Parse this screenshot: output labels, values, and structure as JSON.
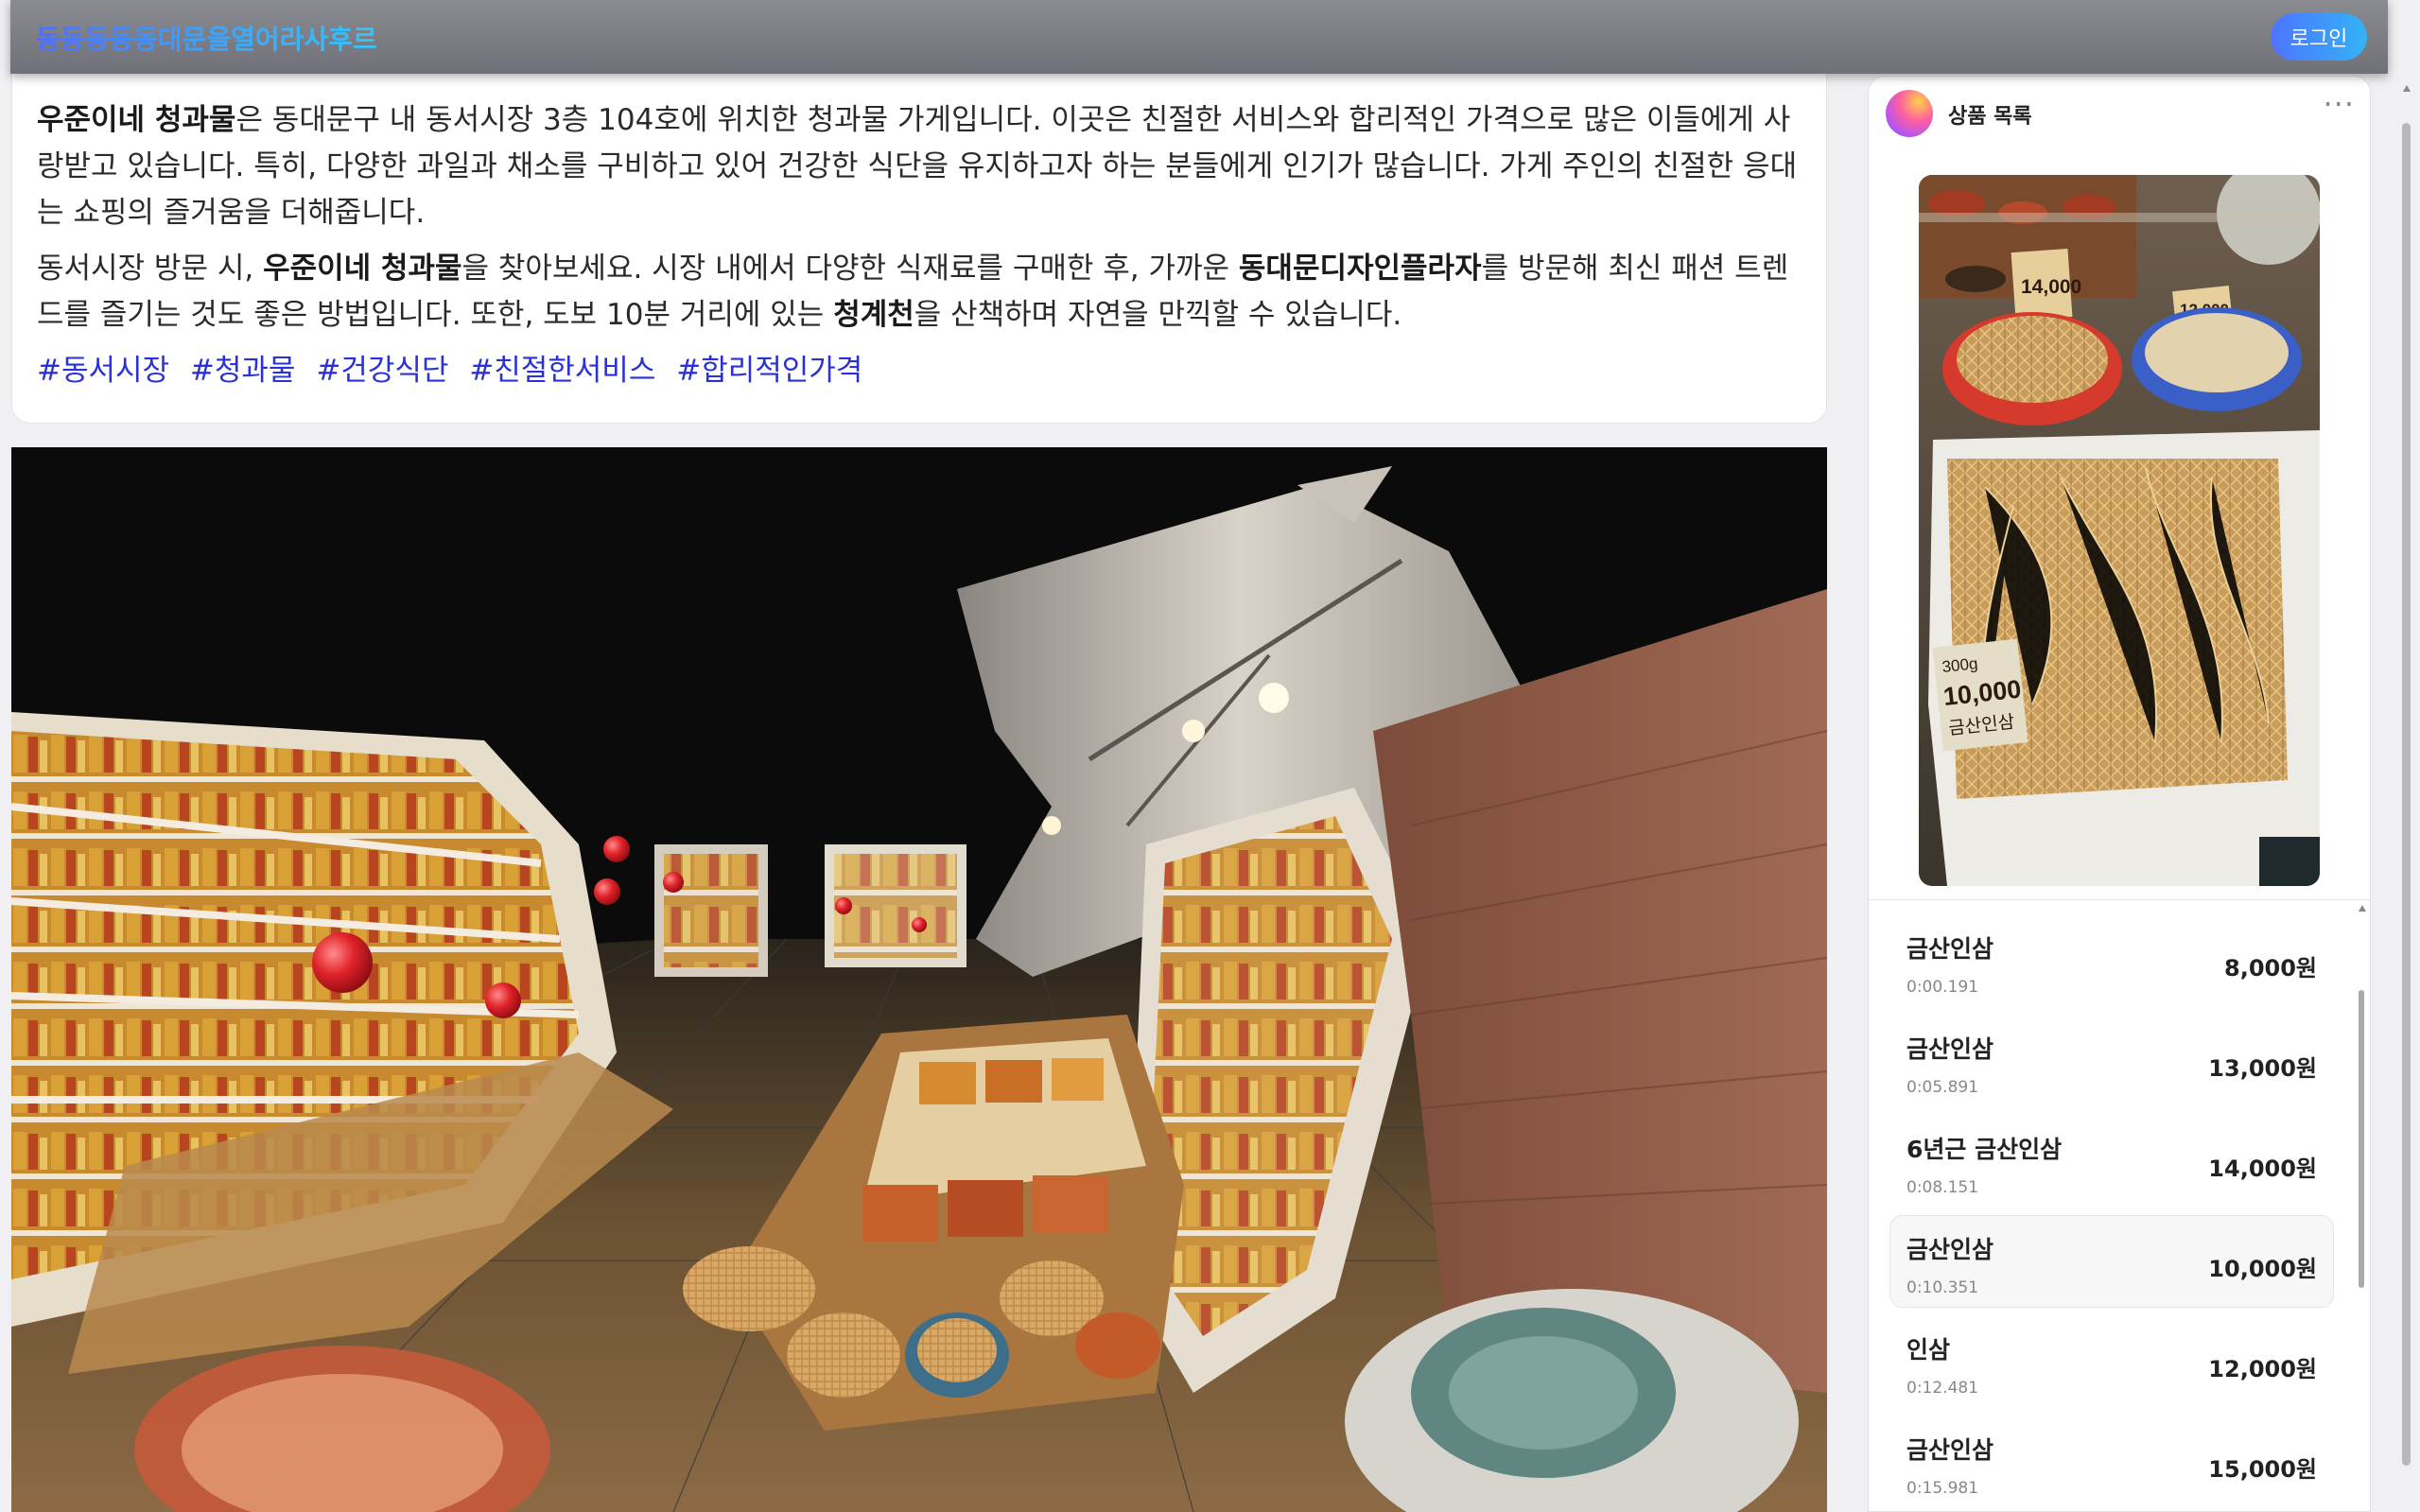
{
  "header": {
    "brand": "동동동동동대문을열어라사후르",
    "login_label": "로그인"
  },
  "description": {
    "p1_store": "우준이네 청과물",
    "p1_rest": "은 동대문구 내 동서시장 3층 104호에 위치한 청과물 가게입니다. 이곳은 친절한 서비스와 합리적인 가격으로 많은 이들에게 사랑받고 있습니다. 특히, 다양한 과일과 채소를 구비하고 있어 건강한 식단을 유지하고자 하는 분들에게 인기가 많습니다. 가게 주인의 친절한 응대는 쇼핑의 즐거움을 더해줍니다.",
    "p2_a": "동서시장 방문 시, ",
    "p2_store": "우준이네 청과물",
    "p2_b": "을 찾아보세요. 시장 내에서 다양한 식재료를 구매한 후, 가까운 ",
    "p2_place1": "동대문디자인플라자",
    "p2_c": "를 방문해 최신 패션 트렌드를 즐기는 것도 좋은 방법입니다. 또한, 도보 10분 거리에 있는 ",
    "p2_place2": "청계천",
    "p2_d": "을 산책하며 자연을 만끽할 수 있습니다.",
    "hashtags": [
      "#동서시장",
      "#청과물",
      "#건강식단",
      "#친절한서비스",
      "#합리적인가격"
    ]
  },
  "panel": {
    "title": "상품 목록",
    "more": "···",
    "thumbnail_labels": {
      "price_sign_1": "14,000",
      "price_sign_2": "12,000",
      "price_card_weight": "300g",
      "price_card_price": "10,000",
      "price_card_name": "금산인삼"
    },
    "items": [
      {
        "name": "금산인삼",
        "time": "0:00.191",
        "price": "8,000원",
        "selected": false
      },
      {
        "name": "금산인삼",
        "time": "0:05.891",
        "price": "13,000원",
        "selected": false
      },
      {
        "name": "6년근 금산인삼",
        "time": "0:08.151",
        "price": "14,000원",
        "selected": false
      },
      {
        "name": "금산인삼",
        "time": "0:10.351",
        "price": "10,000원",
        "selected": true
      },
      {
        "name": "인삼",
        "time": "0:12.481",
        "price": "12,000원",
        "selected": false
      },
      {
        "name": "금산인삼",
        "time": "0:15.981",
        "price": "15,000원",
        "selected": false
      }
    ]
  },
  "viewer": {
    "icon": "3d-pointcloud-scene",
    "marker_color": "#e0222a"
  }
}
